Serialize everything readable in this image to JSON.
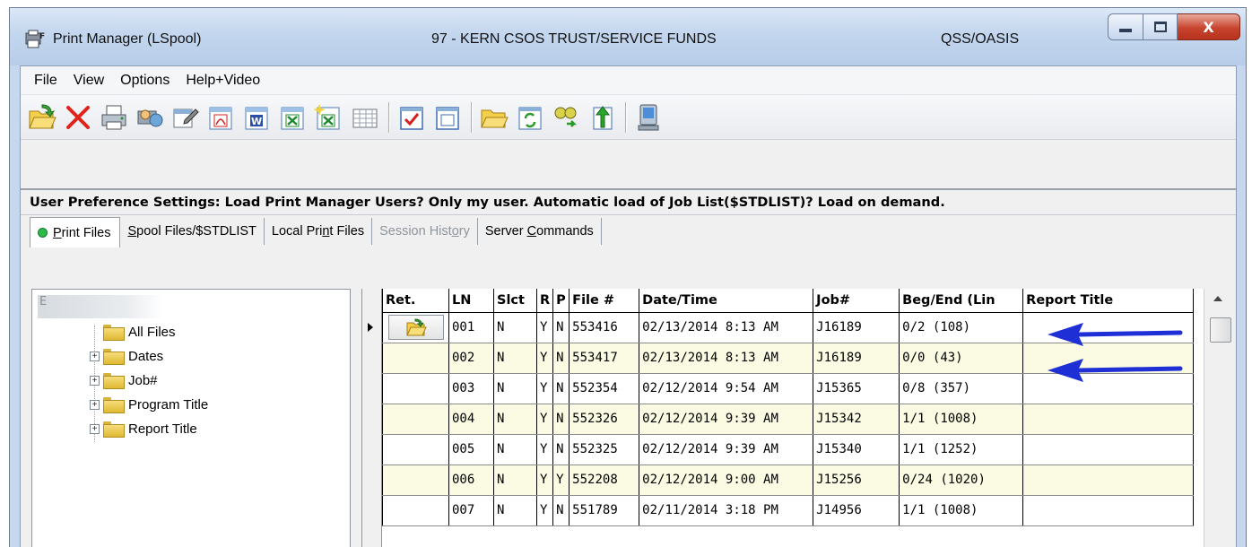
{
  "window": {
    "title": "Print Manager (LSpool)",
    "subtitle": "97 - KERN CSOS TRUST/SERVICE FUNDS",
    "system": "QSS/OASIS",
    "buttons": {
      "minimize": "minimize",
      "maximize": "maximize",
      "close": "X"
    }
  },
  "menu": [
    "File",
    "View",
    "Options",
    "Help+Video"
  ],
  "toolbar": {
    "icons": [
      "open-folder-icon",
      "delete-icon",
      "print-icon",
      "printer-setup-icon",
      "edit-properties-icon",
      "pdf-export-icon",
      "word-export-icon",
      "excel-export-icon",
      "excel-new-export-icon",
      "grid-view-icon",
      "select-all-icon",
      "deselect-all-icon",
      "browse-folder-icon",
      "refresh-icon",
      "find-icon",
      "upload-icon",
      "remote-computer-icon"
    ]
  },
  "preferences": "User Preference Settings: Load Print Manager Users? Only my user.   Automatic load of Job List($STDLIST)? Load on demand.",
  "tabs": [
    {
      "pre": "",
      "u": "P",
      "post": "rint Files",
      "state": "active"
    },
    {
      "pre": "",
      "u": "S",
      "post": "pool Files/$STDLIST",
      "state": "normal"
    },
    {
      "pre": "Local Pri",
      "u": "n",
      "post": "t Files",
      "state": "normal"
    },
    {
      "pre": "Session Hist",
      "u": "o",
      "post": "ry",
      "state": "disabled"
    },
    {
      "pre": "Server ",
      "u": "C",
      "post": "ommands",
      "state": "normal"
    }
  ],
  "tree": {
    "root": "E",
    "items": [
      {
        "label": "All Files",
        "expandable": false
      },
      {
        "label": "Dates",
        "expandable": true
      },
      {
        "label": "Job#",
        "expandable": true
      },
      {
        "label": "Program Title",
        "expandable": true
      },
      {
        "label": "Report Title",
        "expandable": true
      }
    ]
  },
  "grid": {
    "columns": [
      "Ret.",
      "LN",
      "Slct",
      "R",
      "P",
      "File #",
      "Date/Time",
      "Job#",
      "Beg/End (Lin",
      "Report Title"
    ],
    "rows": [
      {
        "ret": true,
        "ln": "001",
        "slct": "N",
        "r": "Y",
        "p": "N",
        "file": "553416",
        "datetime": "02/13/2014  8:13 AM",
        "job": "J16189",
        "begend": "0/2 (108)",
        "title": ""
      },
      {
        "ret": false,
        "ln": "002",
        "slct": "N",
        "r": "Y",
        "p": "N",
        "file": "553417",
        "datetime": "02/13/2014  8:13 AM",
        "job": "J16189",
        "begend": "0/0 (43)",
        "title": ""
      },
      {
        "ret": false,
        "ln": "003",
        "slct": "N",
        "r": "Y",
        "p": "N",
        "file": "552354",
        "datetime": "02/12/2014  9:54 AM",
        "job": "J15365",
        "begend": "0/8 (357)",
        "title": ""
      },
      {
        "ret": false,
        "ln": "004",
        "slct": "N",
        "r": "Y",
        "p": "N",
        "file": "552326",
        "datetime": "02/12/2014  9:39 AM",
        "job": "J15342",
        "begend": "1/1 (1008)",
        "title": ""
      },
      {
        "ret": false,
        "ln": "005",
        "slct": "N",
        "r": "Y",
        "p": "N",
        "file": "552325",
        "datetime": "02/12/2014  9:39 AM",
        "job": "J15340",
        "begend": "1/1 (1252)",
        "title": ""
      },
      {
        "ret": false,
        "ln": "006",
        "slct": "N",
        "r": "Y",
        "p": "Y",
        "file": "552208",
        "datetime": "02/12/2014  9:00 AM",
        "job": "J15256",
        "begend": "0/24 (1020)",
        "title": ""
      },
      {
        "ret": false,
        "ln": "007",
        "slct": "N",
        "r": "Y",
        "p": "N",
        "file": "551789",
        "datetime": "02/11/2014  3:18 PM",
        "job": "J14956",
        "begend": "1/1 (1008)",
        "title": ""
      }
    ]
  },
  "colors": {
    "annotation_arrow": "#1f2fd6",
    "alt_row": "#fbfbe3",
    "title_bar": "#c3d6ee"
  }
}
